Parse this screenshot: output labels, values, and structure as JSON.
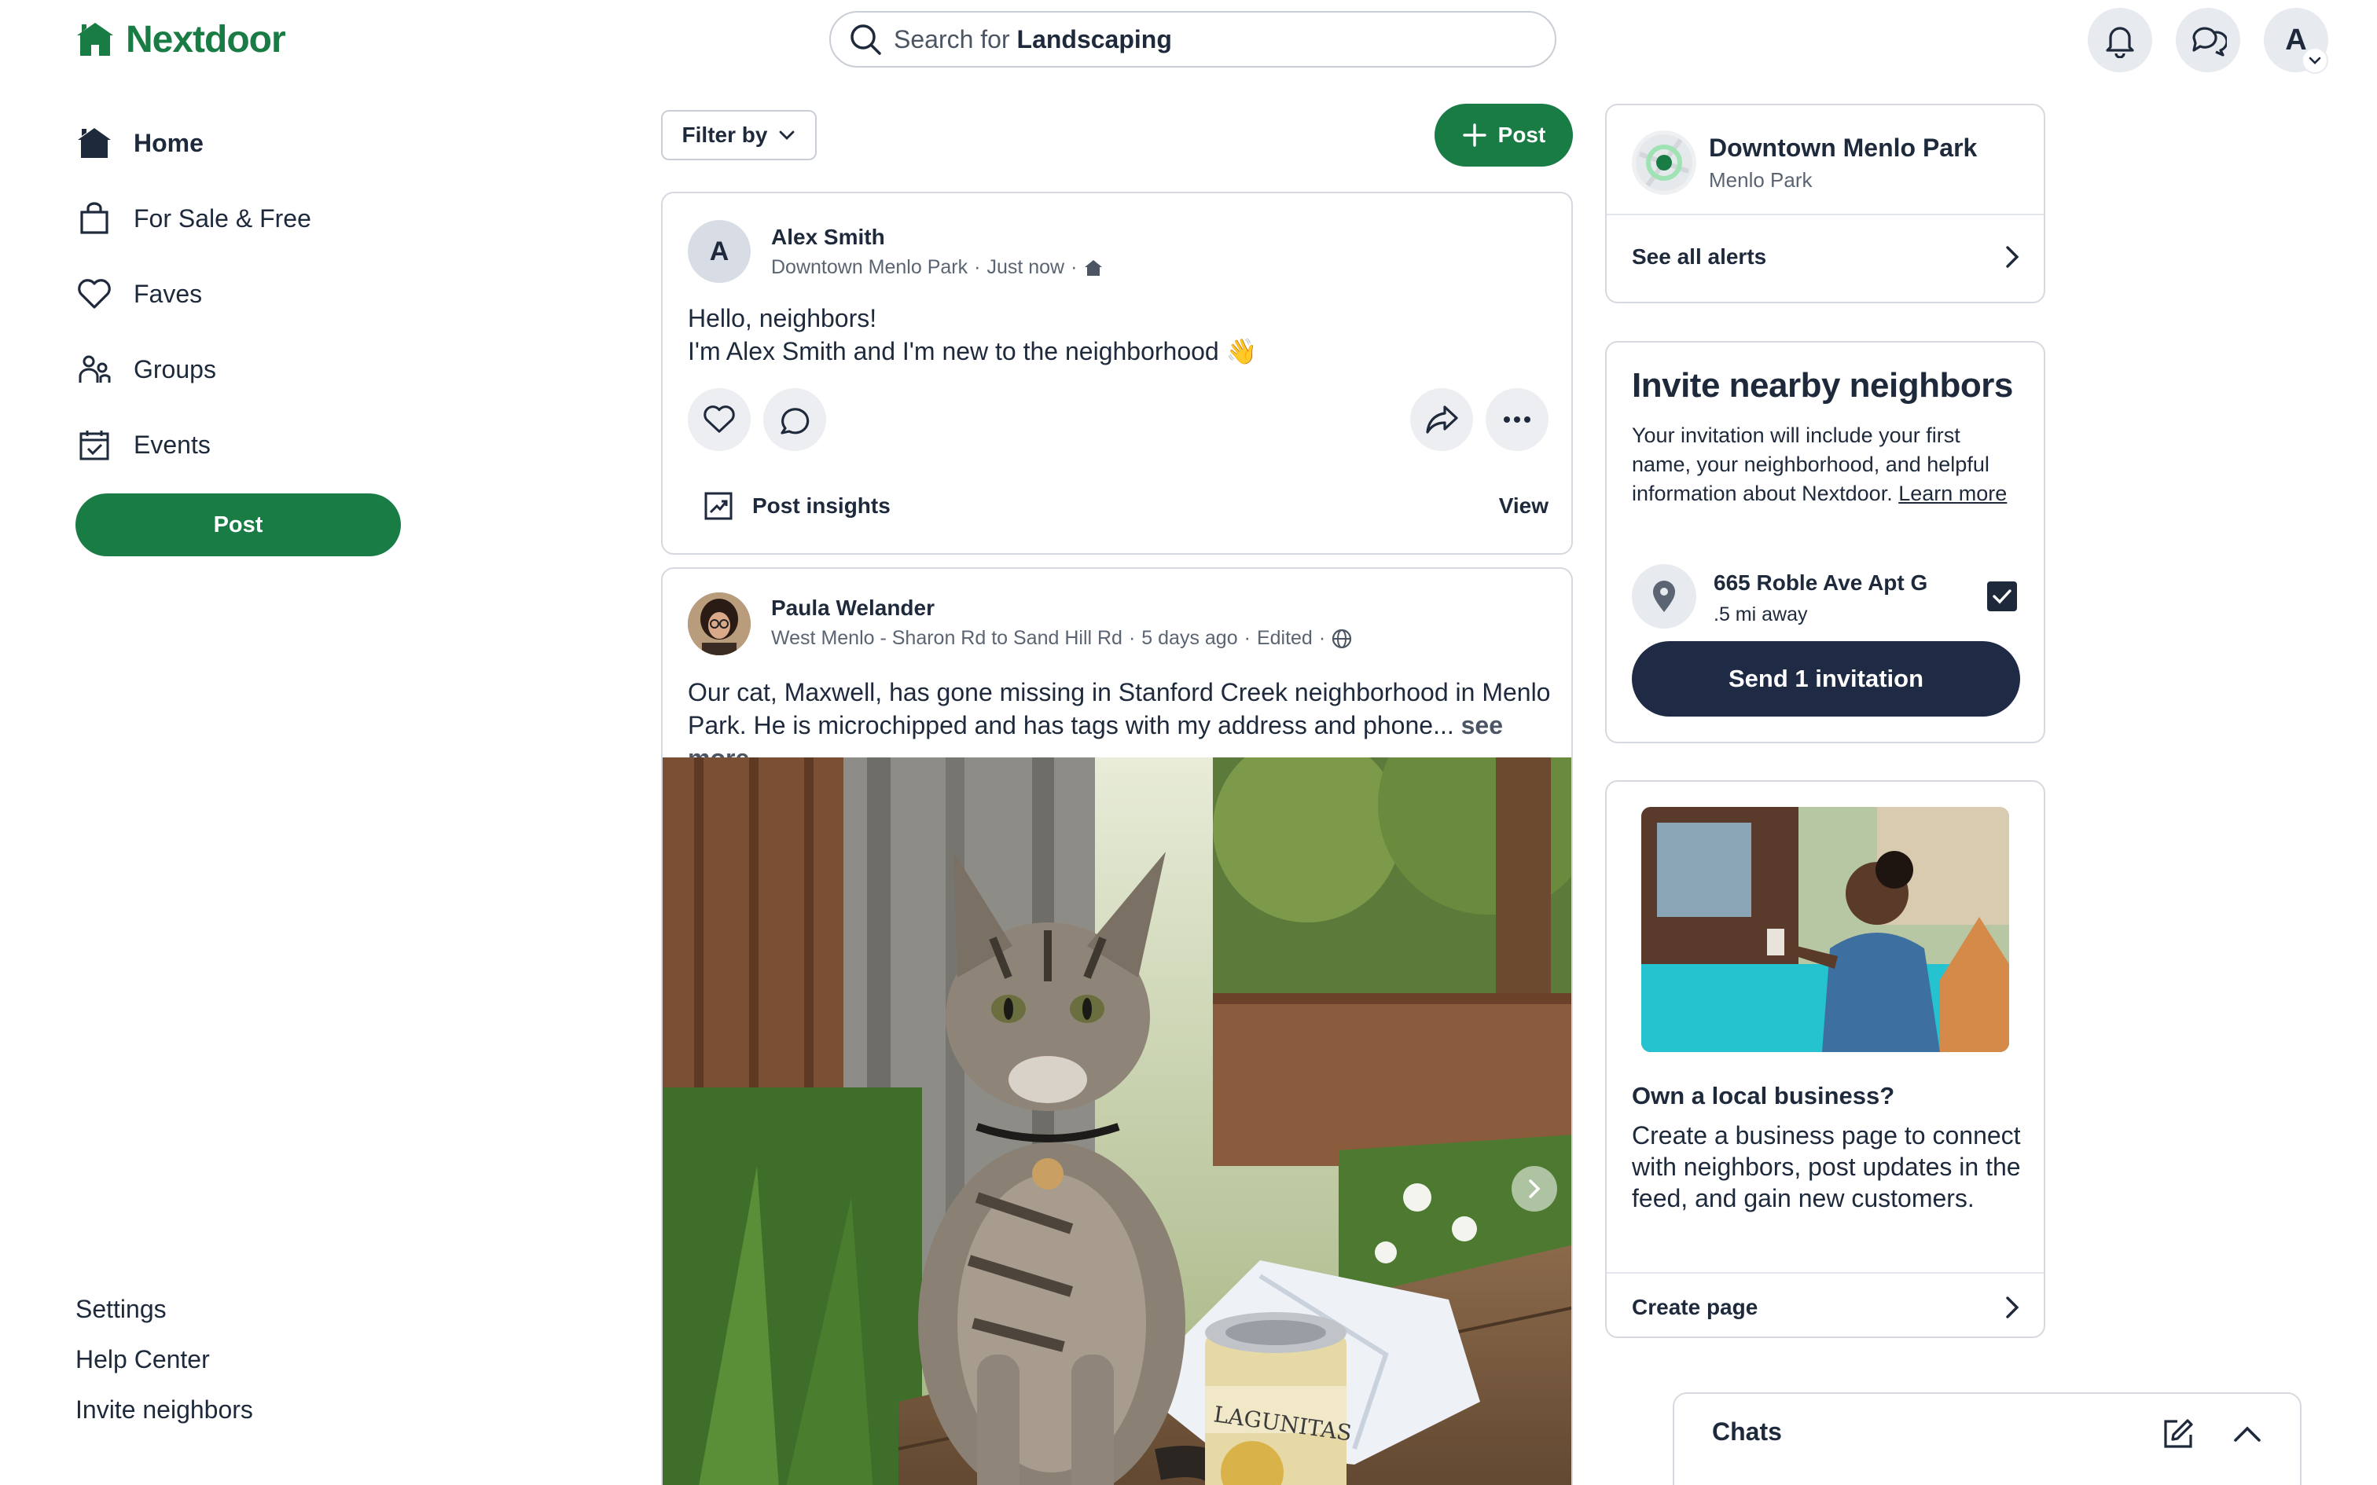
{
  "header": {
    "logo_text": "Nextdoor",
    "search_prefix": "Search for",
    "search_term": "Landscaping"
  },
  "avatar_initial": "A",
  "nav": {
    "items": [
      {
        "label": "Home",
        "icon": "house-icon"
      },
      {
        "label": "For Sale & Free",
        "icon": "shopping-bag-icon"
      },
      {
        "label": "Faves",
        "icon": "heart-icon"
      },
      {
        "label": "Groups",
        "icon": "people-icon"
      },
      {
        "label": "Events",
        "icon": "calendar-icon"
      }
    ],
    "post_label": "Post",
    "footer_links": [
      "Settings",
      "Help Center",
      "Invite neighbors"
    ]
  },
  "feed": {
    "filter_label": "Filter by",
    "post_label": "Post",
    "post1": {
      "avatar_initial": "A",
      "author": "Alex Smith",
      "neighborhood": "Downtown Menlo Park",
      "time": "Just now",
      "line1": "Hello, neighbors!",
      "line2": "I'm Alex Smith and I'm new to the neighborhood 👋",
      "insights_label": "Post insights",
      "view_label": "View"
    },
    "post2": {
      "author": "Paula Welander",
      "neighborhood": "West Menlo - Sharon Rd to Sand Hill Rd",
      "time": "5 days ago",
      "edited": "Edited",
      "line1": "Our cat, Maxwell, has gone missing in Stanford Creek neighborhood in Menlo",
      "line2": "Park. He is microchipped and has tags with my address and phone...",
      "see_more": "see more",
      "can_text": "LAGUNITAS"
    }
  },
  "right": {
    "alerts": {
      "name": "Downtown Menlo Park",
      "sub": "Menlo Park",
      "link": "See all alerts"
    },
    "invite": {
      "title": "Invite nearby neighbors",
      "text": "Your invitation will include your first name, your neighborhood, and helpful information about Nextdoor.",
      "learn_more": "Learn more",
      "address": "665 Roble Ave Apt G",
      "distance": ".5 mi away",
      "button": "Send 1 invitation"
    },
    "business": {
      "title": "Own a local business?",
      "text": "Create a business page to connect with neighbors, post updates in the feed, and gain new customers.",
      "link": "Create page"
    }
  },
  "chats": {
    "label": "Chats"
  },
  "colors": {
    "brand_green": "#1a7c45",
    "navy": "#1f2a44",
    "text": "#1e2a3c"
  }
}
